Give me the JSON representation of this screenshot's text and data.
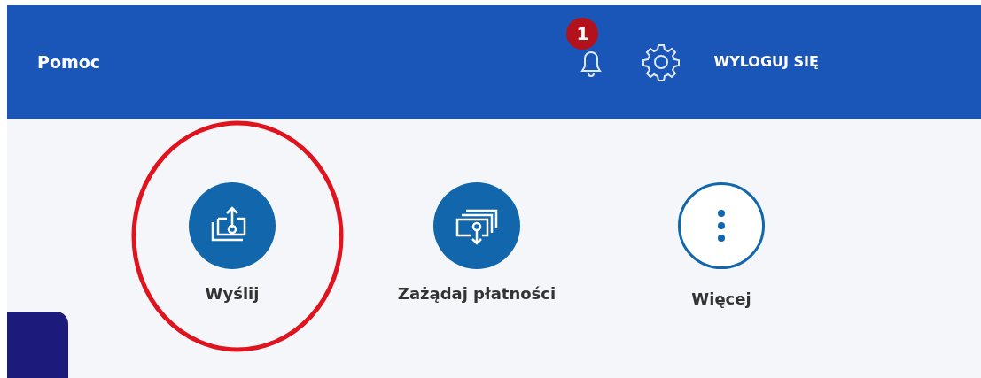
{
  "header": {
    "help_link": "Pomoc",
    "notifications": {
      "count": "1"
    },
    "logout": "WYLOGUJ SIĘ"
  },
  "actions": [
    {
      "label": "Wyślij",
      "kind": "send",
      "highlighted": true
    },
    {
      "label": "Zażądaj płatności",
      "kind": "request",
      "highlighted": false
    },
    {
      "label": "Więcej",
      "kind": "more",
      "highlighted": false
    }
  ]
}
